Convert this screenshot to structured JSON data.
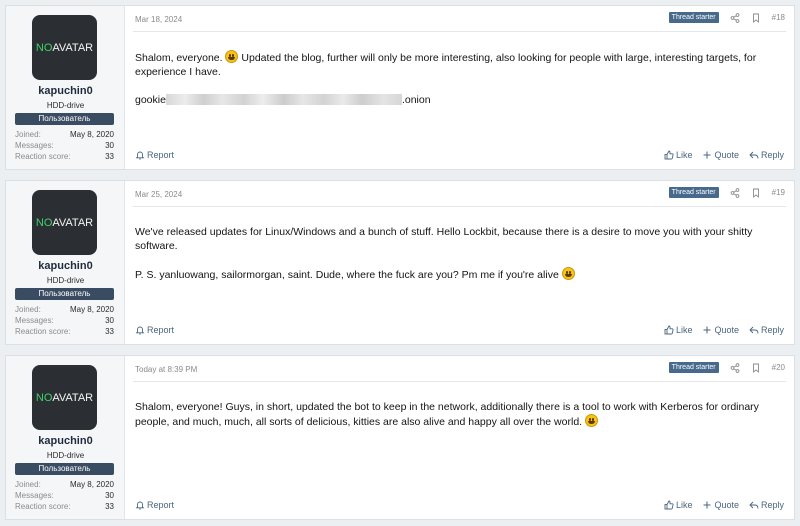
{
  "colors": {
    "page_bg": "#eceff2",
    "badge_bg": "#3a4c61",
    "thread_starter_bg": "#47698b",
    "avatar_bg": "#2b2f33",
    "avatar_no": "#3fd36a",
    "link": "#4a6580"
  },
  "posts": [
    {
      "user": {
        "avatar_no": "NO",
        "avatar_rest": "AVATAR",
        "name": "kapuchin0",
        "title": "HDD-drive",
        "badge": "Пользователь",
        "joined_label": "Joined:",
        "joined": "May 8, 2020",
        "messages_label": "Messages:",
        "messages": "30",
        "reaction_label": "Reaction score:",
        "reaction": "33"
      },
      "date": "Mar 18, 2024",
      "thread_starter": "Thread starter",
      "number": "#18",
      "text1": "Shalom, everyone.",
      "text2": "Updated the blog, further will only be more interesting, also looking for people with large, interesting targets, for experience I have.",
      "link_prefix": "gookie",
      "link_suffix": ".onion",
      "report": "Report",
      "like": "Like",
      "quote": "Quote",
      "reply": "Reply",
      "icons": [
        "share-icon",
        "bookmark-icon",
        "bell-icon",
        "thumbs-up-icon",
        "plus-icon",
        "reply-icon",
        "grinning-emoji"
      ]
    },
    {
      "user": {
        "avatar_no": "NO",
        "avatar_rest": "AVATAR",
        "name": "kapuchin0",
        "title": "HDD-drive",
        "badge": "Пользователь",
        "joined_label": "Joined:",
        "joined": "May 8, 2020",
        "messages_label": "Messages:",
        "messages": "30",
        "reaction_label": "Reaction score:",
        "reaction": "33"
      },
      "date": "Mar 25, 2024",
      "thread_starter": "Thread starter",
      "number": "#19",
      "p1": "We've released updates for Linux/Windows and a bunch of stuff. Hello Lockbit, because there is a desire to move you with your shitty software.",
      "p2": "P. S. yanluowang, sailormorgan, saint. Dude, where the fuck are you? Pm me if you're alive",
      "report": "Report",
      "like": "Like",
      "quote": "Quote",
      "reply": "Reply"
    },
    {
      "user": {
        "avatar_no": "NO",
        "avatar_rest": "AVATAR",
        "name": "kapuchin0",
        "title": "HDD-drive",
        "badge": "Пользователь",
        "joined_label": "Joined:",
        "joined": "May 8, 2020",
        "messages_label": "Messages:",
        "messages": "30",
        "reaction_label": "Reaction score:",
        "reaction": "33"
      },
      "date": "Today at 8:39 PM",
      "thread_starter": "Thread starter",
      "number": "#20",
      "p1": "Shalom, everyone! Guys, in short, updated the bot to keep in the network, additionally there is a tool to work with Kerberos for ordinary people, and much, much, all sorts of delicious, kitties are also alive and happy all over the world.",
      "report": "Report",
      "like": "Like",
      "quote": "Quote",
      "reply": "Reply"
    }
  ]
}
